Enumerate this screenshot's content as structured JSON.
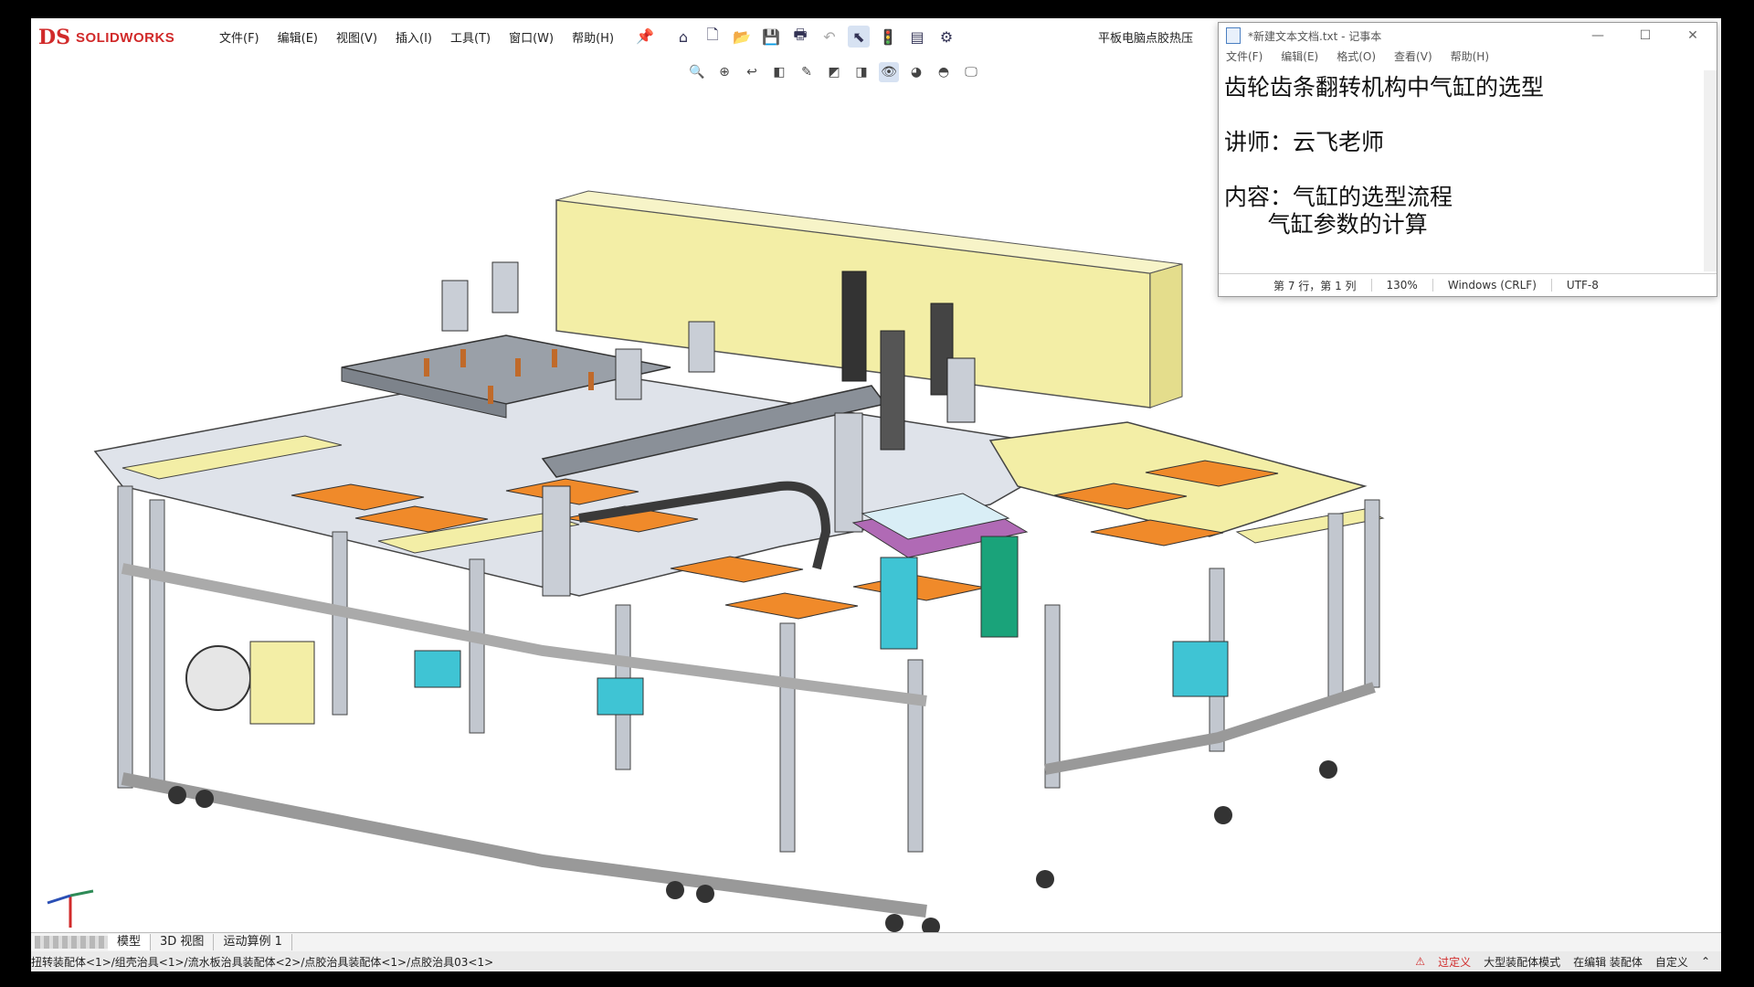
{
  "solidworks": {
    "logo_ds": "DS",
    "logo_name": "SOLIDWORKS",
    "menu": [
      "文件(F)",
      "编辑(E)",
      "视图(V)",
      "插入(I)",
      "工具(T)",
      "窗口(W)",
      "帮助(H)"
    ],
    "document_title": "平板电脑点胶热压"
  },
  "bottom_tabs": [
    "模型",
    "3D 视图",
    "运动算例 1"
  ],
  "status": {
    "path": "扭转装配体<1>/组壳治具<1>/流水板治具装配体<2>/点胶治具装配体<1>/点胶治具03<1>",
    "warning": "过定义",
    "mode": "大型装配体模式",
    "editing": "在编辑 装配体",
    "units": "自定义"
  },
  "notepad": {
    "title": "*新建文本文档.txt - 记事本",
    "menu": [
      "文件(F)",
      "编辑(E)",
      "格式(O)",
      "查看(V)",
      "帮助(H)"
    ],
    "lines": [
      "齿轮齿条翻转机构中气缸的选型",
      "",
      "讲师：云飞老师",
      "",
      "内容：气缸的选型流程",
      "      气缸参数的计算"
    ],
    "status_position": "第 7 行，第 1 列",
    "status_zoom": "130%",
    "status_eol": "Windows (CRLF)",
    "status_encoding": "UTF-8"
  },
  "colors": {
    "sw_red": "#d12a2a",
    "model_yellow": "#f3eea6",
    "model_orange": "#f08a2a",
    "frame_gray": "#b8bec8"
  }
}
